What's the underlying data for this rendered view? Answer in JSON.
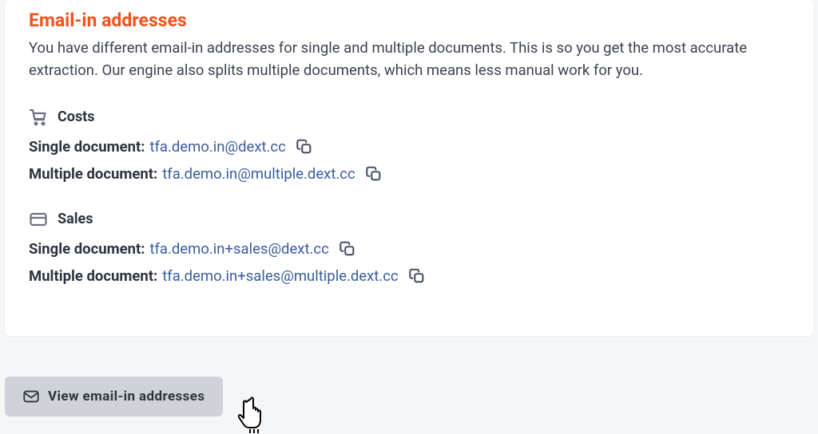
{
  "header": {
    "title": "Email-in addresses",
    "description": "You have different email-in addresses for single and multiple documents. This is so you get the most accurate extraction. Our engine also splits multiple documents, which means less manual work for you."
  },
  "sections": {
    "costs": {
      "title": "Costs",
      "single_label": "Single document:",
      "single_email": "tfa.demo.in@dext.cc",
      "multiple_label": "Multiple document:",
      "multiple_email": "tfa.demo.in@multiple.dext.cc"
    },
    "sales": {
      "title": "Sales",
      "single_label": "Single document:",
      "single_email": "tfa.demo.in+sales@dext.cc",
      "multiple_label": "Multiple document:",
      "multiple_email": "tfa.demo.in+sales@multiple.dext.cc"
    }
  },
  "footer": {
    "view_button_label": "View email-in addresses"
  }
}
